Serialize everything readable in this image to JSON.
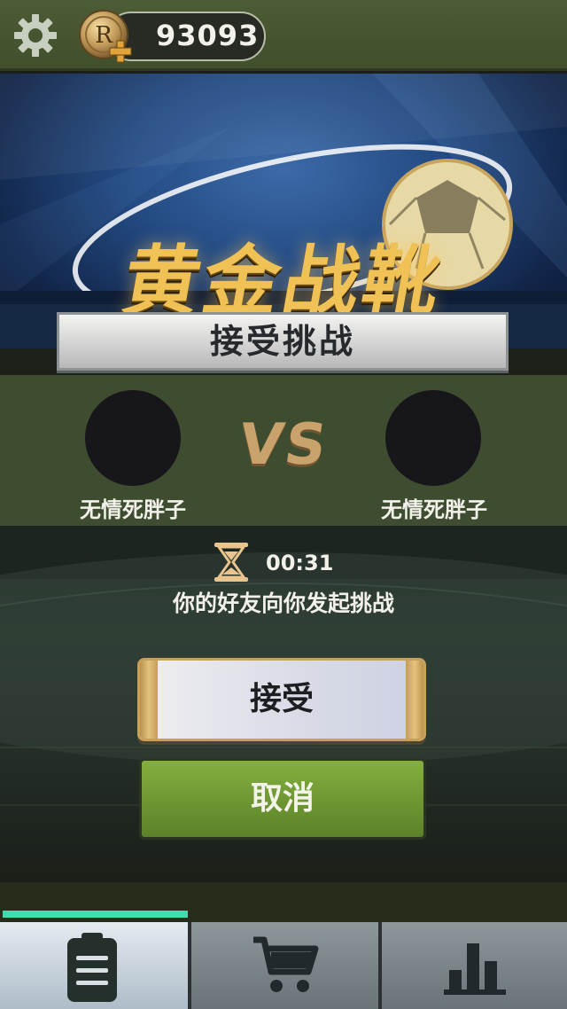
{
  "topbar": {
    "coin_amount": "93093",
    "coin_symbol": "R",
    "icons": {
      "settings": "gear-icon",
      "currency": "coin-icon",
      "add": "plus-icon"
    }
  },
  "banner": {
    "logo_text": "黄金战靴",
    "title": "接受挑战"
  },
  "match": {
    "player_left": "无情死胖子",
    "vs_label": "VS",
    "player_right": "无情死胖子"
  },
  "invite": {
    "countdown": "00:31",
    "message": "你的好友向你发起挑战",
    "accept_label": "接受",
    "cancel_label": "取消",
    "icon": "hourglass-icon"
  },
  "progress": {
    "fraction": 0.33,
    "color": "#3fdcb0"
  },
  "tabs": [
    {
      "icon": "clipboard-icon",
      "active": true
    },
    {
      "icon": "shopping-cart-icon",
      "active": false
    },
    {
      "icon": "bar-chart-icon",
      "active": false
    }
  ],
  "colors": {
    "accent_green": "#6d9632",
    "gold": "#c9a36b",
    "progress": "#3fdcb0"
  }
}
